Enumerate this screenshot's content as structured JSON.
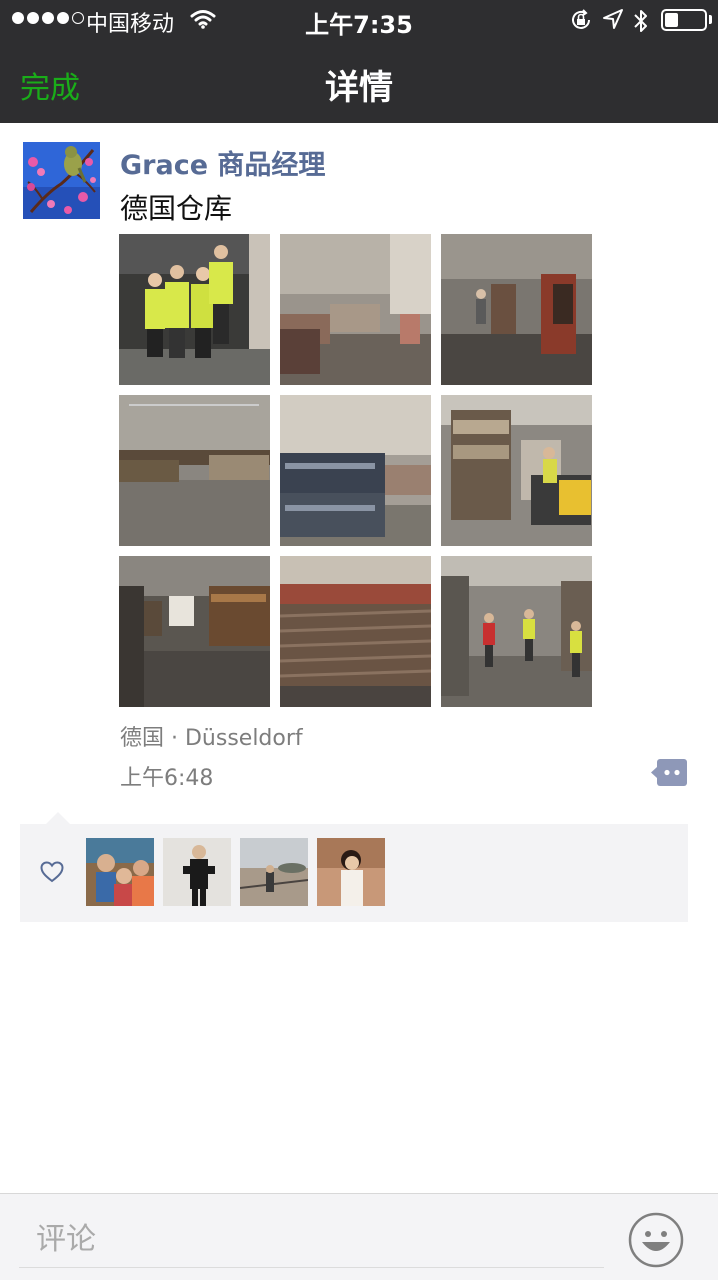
{
  "status_bar": {
    "carrier": "中国移动",
    "time": "上午7:35",
    "battery_level": 0.35,
    "signal_bars_filled": 4,
    "signal_bars_total": 5
  },
  "nav": {
    "back_label": "完成",
    "title": "详情"
  },
  "post": {
    "author": "Grace 商品经理",
    "text": "德国仓库",
    "location": "德国 · Düsseldorf",
    "time": "上午6:48",
    "photo_count": 9
  },
  "comment_box": {
    "placeholder": "评论"
  },
  "colors": {
    "nav_background": "#2e2e30",
    "accent_green": "#1aad19",
    "author_blue": "#576b95",
    "meta_gray": "#7d7d7d",
    "likes_background": "#f3f3f5"
  },
  "icons": [
    "wifi-icon",
    "lock-rotation-icon",
    "location-arrow-icon",
    "bluetooth-icon",
    "battery-icon",
    "comment-icon",
    "heart-icon",
    "emoji-icon"
  ]
}
